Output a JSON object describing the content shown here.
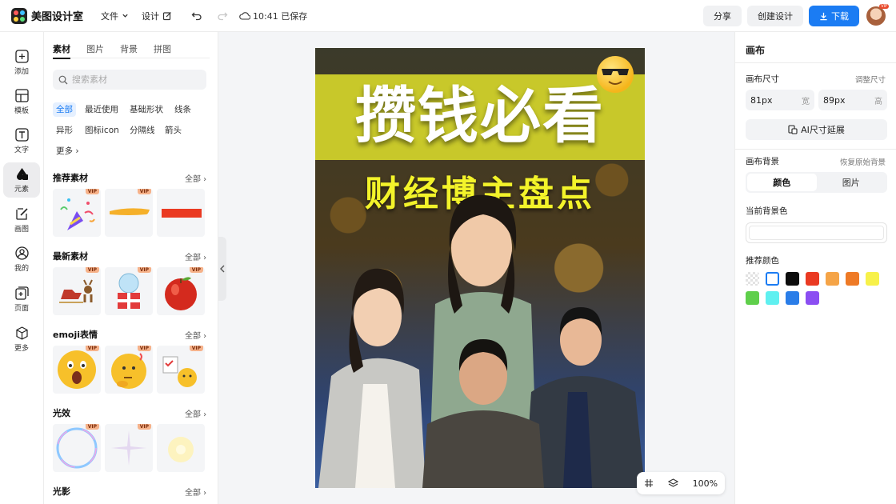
{
  "app": {
    "name": "美图设计室"
  },
  "topbar": {
    "file_label": "文件",
    "design_label": "设计",
    "saved_text": "10:41 已保存",
    "share_label": "分享",
    "create_label": "创建设计",
    "download_label": "下载",
    "avatar_badge": "VIP"
  },
  "leftnav": {
    "items": [
      {
        "label": "添加",
        "icon": "plus-square-icon"
      },
      {
        "label": "模板",
        "icon": "template-icon"
      },
      {
        "label": "文字",
        "icon": "text-icon"
      },
      {
        "label": "元素",
        "icon": "shapes-icon"
      },
      {
        "label": "画图",
        "icon": "draw-icon"
      },
      {
        "label": "我的",
        "icon": "user-icon"
      },
      {
        "label": "页面",
        "icon": "page-icon"
      },
      {
        "label": "更多",
        "icon": "cube-icon"
      }
    ]
  },
  "panel": {
    "tabs": [
      "素材",
      "图片",
      "背景",
      "拼图"
    ],
    "search_placeholder": "搜索素材",
    "chips": [
      "全部",
      "最近使用",
      "基础形状",
      "线条",
      "异形",
      "图标icon",
      "分隔线",
      "箭头",
      "更多"
    ],
    "sections": [
      {
        "title": "推荐素材",
        "all": "全部"
      },
      {
        "title": "最新素材",
        "all": "全部"
      },
      {
        "title": "emoji表情",
        "all": "全部"
      },
      {
        "title": "光效",
        "all": "全部"
      },
      {
        "title": "光影",
        "all": "全部"
      }
    ],
    "vip": "VIP"
  },
  "poster": {
    "title": "攒钱必看",
    "subtitle": "财经博主盘点"
  },
  "zoom": {
    "level": "100%"
  },
  "right": {
    "title": "画布",
    "size_label": "画布尺寸",
    "size_link": "调整尺寸",
    "width_value": "81px",
    "width_unit": "宽",
    "height_value": "89px",
    "height_unit": "高",
    "ai_button": "AI尺寸延展",
    "bg_label": "画布背景",
    "bg_link": "恢复原始背景",
    "seg_color": "颜色",
    "seg_image": "图片",
    "current_bg_label": "当前背景色",
    "recommend_label": "推荐颜色",
    "colors": [
      "#f0f0f0",
      "#ffffff",
      "#0d0d0d",
      "#ea3a22",
      "#f5a447",
      "#ee7a26",
      "#f7f14a",
      "#5fcf4b",
      "#5ff0f0",
      "#2a7de8",
      "#8b4ef2"
    ],
    "accent": "#1b7cf3"
  }
}
